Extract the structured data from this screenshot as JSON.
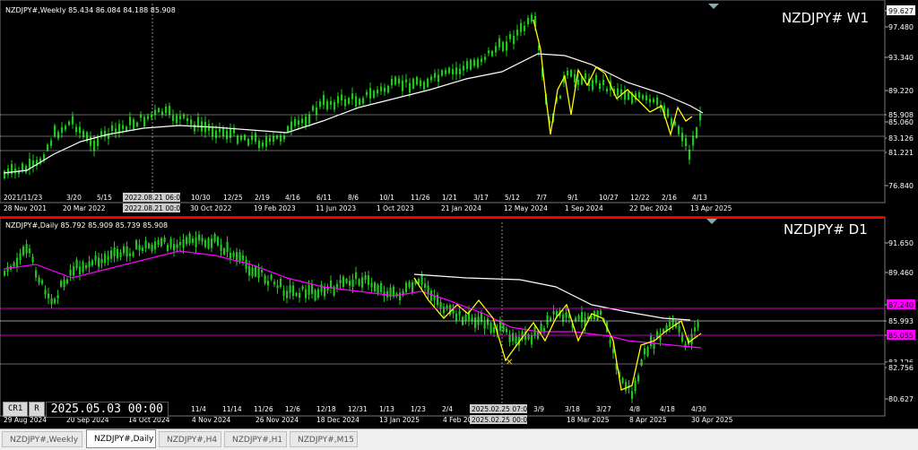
{
  "top_chart": {
    "header": "NZDJPY#,Weekly  85.434 86.084 84.188 85.908",
    "title": "NZDJPY# W1",
    "price_labels": [
      "99.627",
      "97.480",
      "93.340",
      "89.220",
      "85.908",
      "85.060",
      "83.126",
      "81.221",
      "76.840"
    ],
    "date_labels": [
      "2021/11/23",
      "3/20",
      "5/15",
      "2022.08.21 06:00",
      "10/30",
      "12/25",
      "2/19",
      "4/16",
      "6/11",
      "8/6",
      "10/1",
      "11/26",
      "1/21",
      "3/17",
      "5/12",
      "7/7",
      "9/1",
      "10/27",
      "12/22",
      "2/16",
      "4/13"
    ],
    "bottom_dates": [
      "28 Nov 2021",
      "20 Mar 2022",
      "2022.08.21 00:00",
      "30 Oct 2022",
      "19 Feb 2023",
      "11 Jun 2023",
      "1 Oct 2023",
      "21 Jan 2024",
      "12 May 2024",
      "1 Sep 2024",
      "22 Dec 2024",
      "13 Apr 2025"
    ]
  },
  "bottom_chart": {
    "header": "NZDJPY#,Daily  85.792 85.909 85.739 85.908",
    "title": "NZDJPY# D1",
    "price_labels": [
      "91.650",
      "89.460",
      "87.240",
      "85.993",
      "85.055",
      "83.126",
      "82.756",
      "80.627"
    ],
    "date_labels": [
      "11/4",
      "11/14",
      "11/26",
      "12/6",
      "12/18",
      "12/31",
      "1/13",
      "1/23",
      "2/4",
      "2025.02.25 07:00",
      "3/9",
      "3/18",
      "3/27",
      "4/8",
      "4/18",
      "4/30"
    ],
    "bottom_dates": [
      "29 Aug 2024",
      "20 Sep 2024",
      "14 Oct 2024",
      "4 Nov 2024",
      "26 Nov 2024",
      "18 Dec 2024",
      "13 Jan 2025",
      "4 Feb 2025",
      "2025.02.25 00:00",
      "18 Mar 2025",
      "8 Apr 2025",
      "30 Apr 2025"
    ]
  },
  "status": {
    "mode1": "CR1",
    "mode2": "R",
    "datetime": "2025.05.03 00:00"
  },
  "tabs": [
    "NZDJPY#,Weekly",
    "NZDJPY#,Daily",
    "NZDJPY#,H4",
    "NZDJPY#,H1",
    "NZDJPY#,M15"
  ],
  "colors": {
    "candle": "#22c322",
    "ma_white": "#ffffff",
    "ma_magenta": "#ff00ff",
    "zigzag": "#ffff00",
    "separator": "#ff0000"
  }
}
